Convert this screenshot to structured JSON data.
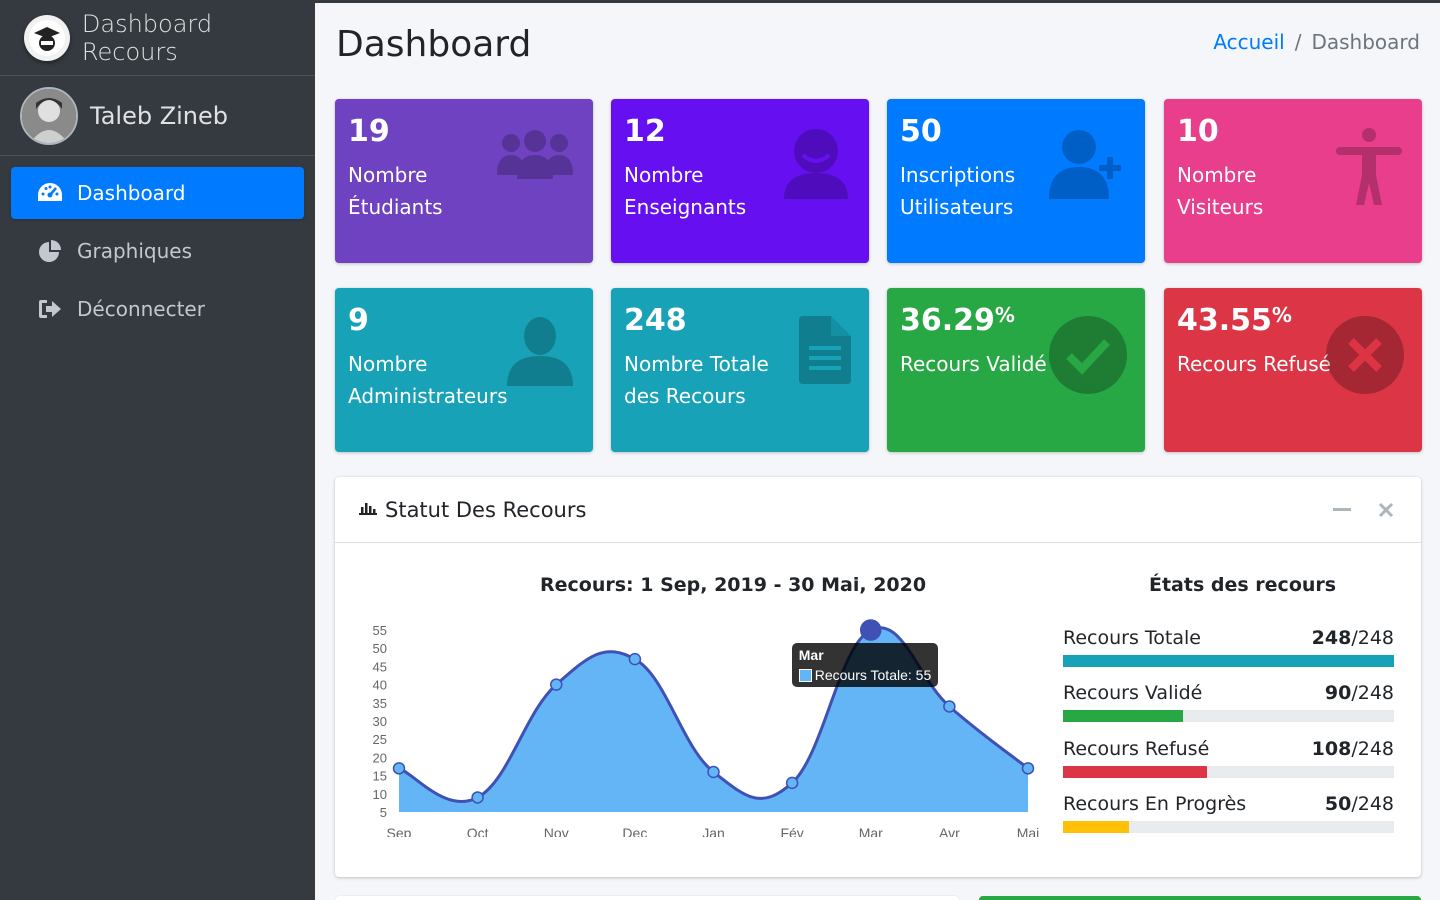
{
  "brand": {
    "title": "Dashboard Recours"
  },
  "user": {
    "name": "Taleb Zineb"
  },
  "sidebar": {
    "items": [
      {
        "label": "Dashboard",
        "icon": "tachometer-icon",
        "active": true
      },
      {
        "label": "Graphiques",
        "icon": "pie-chart-icon",
        "active": false
      },
      {
        "label": "Déconnecter",
        "icon": "sign-out-icon",
        "active": false
      }
    ]
  },
  "header": {
    "title": "Dashboard",
    "breadcrumb": {
      "home": "Accueil",
      "separator": "/",
      "current": "Dashboard"
    }
  },
  "stats": [
    {
      "value": "19",
      "label": "Nombre Étudiants",
      "color": "#6f42c1",
      "icon": "users-icon"
    },
    {
      "value": "12",
      "label": "Nombre Enseignants",
      "color": "#6610f2",
      "icon": "teacher-icon"
    },
    {
      "value": "50",
      "label": "Inscriptions Utilisateurs",
      "color": "#007bff",
      "icon": "user-plus-icon"
    },
    {
      "value": "10",
      "label": "Nombre Visiteurs",
      "color": "#e83e8c",
      "icon": "accessibility-icon"
    },
    {
      "value": "9",
      "label": "Nombre Administrateurs",
      "color": "#17a2b8",
      "icon": "user-icon"
    },
    {
      "value": "248",
      "label": "Nombre Totale des Recours",
      "color": "#17a2b8",
      "icon": "file-icon"
    },
    {
      "value": "36.29",
      "suffix": "%",
      "label": "Recours Validé",
      "color": "#28a745",
      "icon": "check-circle-icon"
    },
    {
      "value": "43.55",
      "suffix": "%",
      "label": "Recours Refusé",
      "color": "#dc3545",
      "icon": "times-circle-icon"
    }
  ],
  "card": {
    "title": "Statut Des Recours",
    "chart_title": "Recours: 1 Sep, 2019 - 30 Mai, 2020",
    "progress_title": "États des recours",
    "tooltip": {
      "title": "Mar",
      "text": "Recours Totale: 55"
    },
    "progress": [
      {
        "label": "Recours Totale",
        "value": "248",
        "total": "/248",
        "fraction": 1.0,
        "color": "#17a2b8"
      },
      {
        "label": "Recours Validé",
        "value": "90",
        "total": "/248",
        "fraction": 0.363,
        "color": "#28a745"
      },
      {
        "label": "Recours Refusé",
        "value": "108",
        "total": "/248",
        "fraction": 0.435,
        "color": "#dc3545"
      },
      {
        "label": "Recours En Progrès",
        "value": "50",
        "total": "/248",
        "fraction": 0.2,
        "color": "#ffc107"
      }
    ]
  },
  "chart_data": {
    "type": "area",
    "title": "Recours: 1 Sep, 2019 - 30 Mai, 2020",
    "categories": [
      "Sep",
      "Oct",
      "Nov",
      "Dec",
      "Jan",
      "Fév",
      "Mar",
      "Avr",
      "Mai"
    ],
    "series": [
      {
        "name": "Recours Totale",
        "values": [
          17,
          9,
          40,
          47,
          16,
          13,
          55,
          34,
          17
        ]
      }
    ],
    "yticks": [
      5,
      10,
      15,
      20,
      25,
      30,
      35,
      40,
      45,
      50,
      55
    ],
    "ylim": [
      5,
      55
    ],
    "fill_color": "#64b5f6",
    "line_color": "#3f51b5",
    "grid": false,
    "legend": "none"
  }
}
